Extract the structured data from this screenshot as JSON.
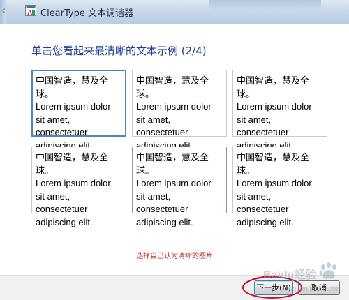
{
  "window": {
    "title": "ClearType 文本调谐器"
  },
  "page": {
    "title": "单击您看起来最清晰的文本示例 (2/4)",
    "hint": "选择自己认为清晰的图片"
  },
  "samples": [
    {
      "text": "中国智造，慧及全球。\nLorem ipsum dolor\nsit amet,\nconsectetuer\nadipiscing elit.",
      "selected": true
    },
    {
      "text": "中国智造，慧及全球。\nLorem ipsum dolor\nsit amet,\nconsectetuer\nadipiscing elit.",
      "selected": false
    },
    {
      "text": "中国智造，慧及全球。\nLorem ipsum dolor\nsit amet,\nconsectetuer\nadipiscing elit.",
      "selected": false
    },
    {
      "text": "中国智造，慧及全球。\nLorem ipsum dolor\nsit amet,\nconsectetuer\nadipiscing elit.",
      "selected": false
    },
    {
      "text": "中国智造，慧及全球。\nLorem ipsum dolor\nsit amet,\nconsectetuer\nadipiscing elit.",
      "selected": false
    },
    {
      "text": "中国智造，慧及全球。\nLorem ipsum dolor\nsit amet,\nconsectetuer\nadipiscing elit.",
      "selected": false
    }
  ],
  "buttons": {
    "next": "下一步(N)",
    "cancel": "取消"
  },
  "watermark": {
    "text": "Baidu经验",
    "url": "jingyan.baidu.com"
  },
  "colors": {
    "title": "#1e3c96",
    "hint": "#c0281e",
    "selected_border": "#4d86c0",
    "annotation": "#c8102e"
  },
  "icons": {
    "back": "back-arrow-icon",
    "app": "cleartype-app-icon"
  }
}
